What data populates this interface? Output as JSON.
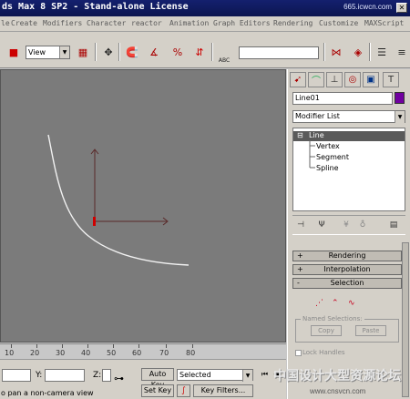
{
  "title_bar": {
    "title": "ds Max 8 SP2  - Stand-alone License",
    "watermark": "665.icwcn.com"
  },
  "menu": [
    {
      "label": "le"
    },
    {
      "label": "Create"
    },
    {
      "label": "Modifiers"
    },
    {
      "label": "Character"
    },
    {
      "label": "reactor"
    },
    {
      "label": "Animation"
    },
    {
      "label": "Graph Editors"
    },
    {
      "label": "Rendering"
    },
    {
      "label": "Customize"
    },
    {
      "label": "MAXScript"
    }
  ],
  "toolbar": {
    "view_dropdown": "View",
    "abc_label": "ABC"
  },
  "command_panel": {
    "object_name": "Line01",
    "object_color": "#7000a0",
    "modifier_list": "Modifier List",
    "stack": {
      "root": "Line",
      "items": [
        "Vertex",
        "Segment",
        "Spline"
      ]
    },
    "rollouts": {
      "rendering": "Rendering",
      "interpolation": "Interpolation",
      "selection": "Selection"
    },
    "named_selections_label": "Named Selections:",
    "copy_label": "Copy",
    "paste_label": "Paste",
    "lock_handles_label": "Lock Handles"
  },
  "ruler": {
    "ticks": [
      "10",
      "20",
      "30",
      "40",
      "50",
      "60",
      "70",
      "80"
    ]
  },
  "status": {
    "y_label": "Y:",
    "z_label": "Z:",
    "prompt": "o pan a non-camera view",
    "auto_key": "Auto Key",
    "set_key": "Set Key",
    "key_mode": "Selected",
    "key_filters": "Key Filters..."
  },
  "watermark_bottom": "中国设计大型资源论坛",
  "watermark_url": "www.cnsvcn.com"
}
